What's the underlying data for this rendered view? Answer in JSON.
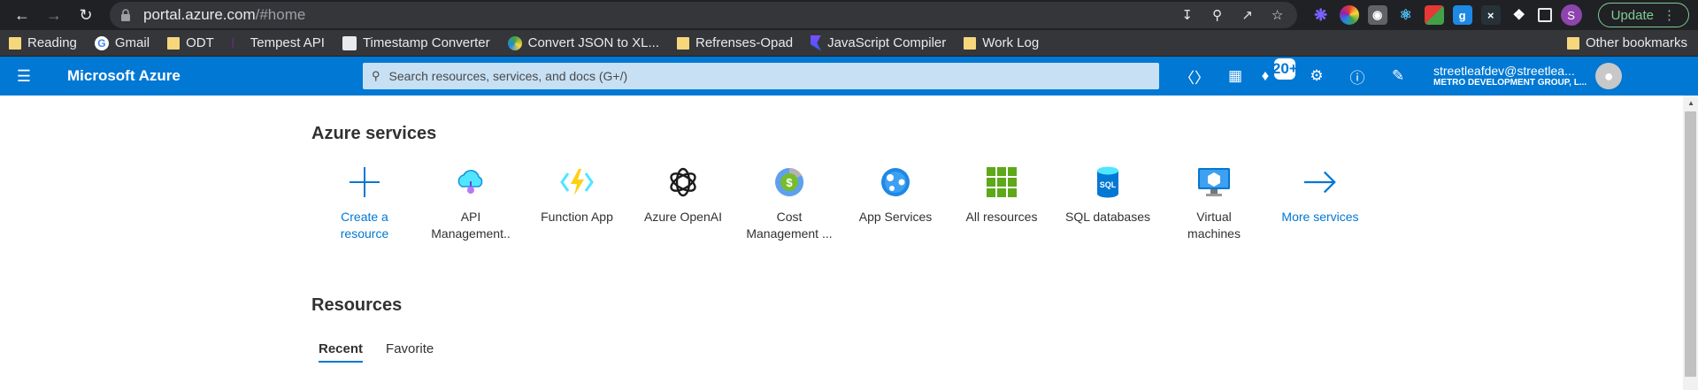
{
  "browser": {
    "url_host": "portal.azure.com",
    "url_path": "/#home",
    "update_label": "Update",
    "profile_initial": "S"
  },
  "bookmarks": {
    "items": [
      {
        "label": "Reading",
        "icon": "folder-icon"
      },
      {
        "label": "Gmail",
        "icon": "google-icon"
      },
      {
        "label": "ODT",
        "icon": "folder-icon"
      },
      {
        "label": "Tempest API",
        "icon": "page-icon"
      },
      {
        "label": "Timestamp Converter",
        "icon": "page-icon"
      },
      {
        "label": "Convert JSON to XL...",
        "icon": "page-icon"
      },
      {
        "label": "Refrenses-Opad",
        "icon": "folder-icon"
      },
      {
        "label": "JavaScript Compiler",
        "icon": "page-icon"
      },
      {
        "label": "Work Log",
        "icon": "folder-icon"
      }
    ],
    "other": "Other bookmarks"
  },
  "azure_header": {
    "brand": "Microsoft Azure",
    "search_placeholder": "Search resources, services, and docs (G+/)",
    "notification_badge": "20+",
    "account_name": "streetleafdev@streetlea...",
    "account_org": "METRO DEVELOPMENT GROUP, L..."
  },
  "services": {
    "title": "Azure services",
    "items": [
      {
        "line1": "Create a",
        "line2": "resource",
        "icon": "plus-icon"
      },
      {
        "line1": "API",
        "line2": "Management..",
        "icon": "api-management-icon"
      },
      {
        "line1": "Function App",
        "line2": "",
        "icon": "function-app-icon"
      },
      {
        "line1": "Azure OpenAI",
        "line2": "",
        "icon": "openai-icon"
      },
      {
        "line1": "Cost",
        "line2": "Management ...",
        "icon": "cost-management-icon"
      },
      {
        "line1": "App Services",
        "line2": "",
        "icon": "app-services-icon"
      },
      {
        "line1": "All resources",
        "line2": "",
        "icon": "all-resources-icon"
      },
      {
        "line1": "SQL databases",
        "line2": "",
        "icon": "sql-database-icon"
      },
      {
        "line1": "Virtual",
        "line2": "machines",
        "icon": "virtual-machine-icon"
      },
      {
        "line1": "More services",
        "line2": "",
        "icon": "arrow-right-icon"
      }
    ]
  },
  "resources": {
    "title": "Resources",
    "tabs": [
      "Recent",
      "Favorite"
    ]
  },
  "colors": {
    "azure_blue": "#0078d4",
    "chrome_dark": "#202124"
  }
}
